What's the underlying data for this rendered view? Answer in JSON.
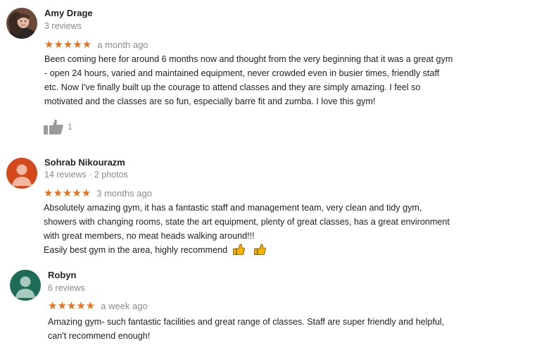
{
  "reviews": [
    {
      "author": "Amy Drage",
      "meta": "3 reviews",
      "stars": "★★★★★",
      "time": "a month ago",
      "text_lines": [
        "Been coming here for around 6 months now and thought from the very beginning that it was a great gym",
        "- open 24 hours, varied and maintained equipment, never crowded even in busier times, friendly staff",
        "etc. Now I've finally built up the courage to attend classes and they are simply amazing. I feel so",
        "motivated and the classes are so fun, especially barre fit and zumba. I love this gym!"
      ],
      "likes": "1",
      "rating": 5
    },
    {
      "author": "Sohrab Nikourazm",
      "meta": "14 reviews · 2 photos",
      "stars": "★★★★★",
      "time": "3 months ago",
      "text_lines": [
        "Absolutely amazing gym, it has a fantastic staff and management team, very clean and tidy gym,",
        "showers with changing rooms, state the art equipment, plenty of great classes, has a great environment",
        "with great members, no meat heads walking around!!!",
        "Easily best gym in the area, highly recommend"
      ],
      "rating": 5,
      "avatar_color": "#d2491b"
    },
    {
      "author": "Robyn",
      "meta": "6 reviews",
      "stars": "★★★★★",
      "time": "a week ago",
      "text_lines": [
        "Amazing gym- such fantastic facilities and great range of classes. Staff are super friendly and helpful,",
        "can't recommend enough!"
      ],
      "rating": 5,
      "avatar_color": "#1e6b57"
    }
  ],
  "colors": {
    "star": "#e7711b",
    "meta_text": "#8a8a8a",
    "body_text": "#222222"
  },
  "icons": [
    "thumbs-up-icon",
    "thumbs-up-emoji-icon",
    "person-icon"
  ]
}
